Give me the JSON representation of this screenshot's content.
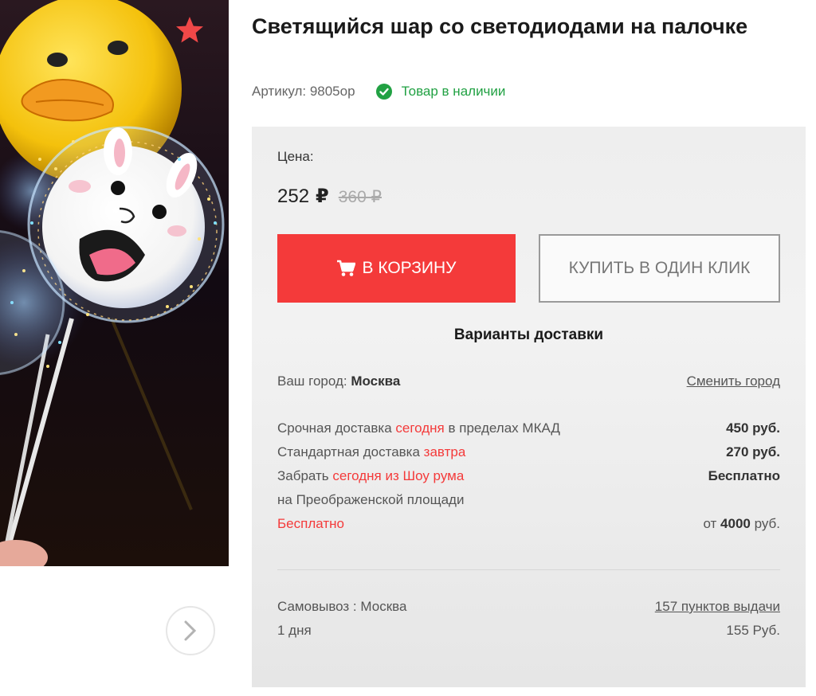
{
  "product": {
    "title": "Светящийся шар со светодиодами на палочке",
    "sku": "Артикул: 9805ор",
    "stock": "Товар в наличии"
  },
  "price": {
    "label": "Цена:",
    "current": "252",
    "currency": "₽",
    "old": "360 ₽"
  },
  "buttons": {
    "cart": "В КОРЗИНУ",
    "one_click": "КУПИТЬ В ОДИН КЛИК"
  },
  "delivery": {
    "title": "Варианты доставки",
    "city_label": "Ваш город:",
    "city": "Москва",
    "change_city": "Сменить город",
    "urgent": {
      "pre": "Срочная доставка ",
      "highlight": "сегодня",
      "post": " в пределах МКАД",
      "price": "450 руб."
    },
    "standard": {
      "pre": "Стандартная доставка ",
      "highlight": "завтра",
      "price": "270 руб."
    },
    "pickup_showroom": {
      "pre": "Забрать ",
      "highlight": "сегодня из Шоу рума",
      "line2": "на Преображенской площади",
      "price": "Бесплатно"
    },
    "free": {
      "label": "Бесплатно",
      "price_pre": "от ",
      "price_value": "4000",
      "price_post": " руб."
    },
    "self_pickup": {
      "label": "Самовывоз : Москва",
      "points": "157 пунктов выдачи",
      "days": "1 дня",
      "price": "155 Руб."
    }
  },
  "colors": {
    "accent": "#f43a3a",
    "stock_green": "#21a143",
    "panel_bg": "#eeeeee"
  },
  "icons": {
    "favorite": "star-icon",
    "stock": "check-circle-icon",
    "cart": "cart-icon",
    "next": "chevron-right-icon"
  }
}
